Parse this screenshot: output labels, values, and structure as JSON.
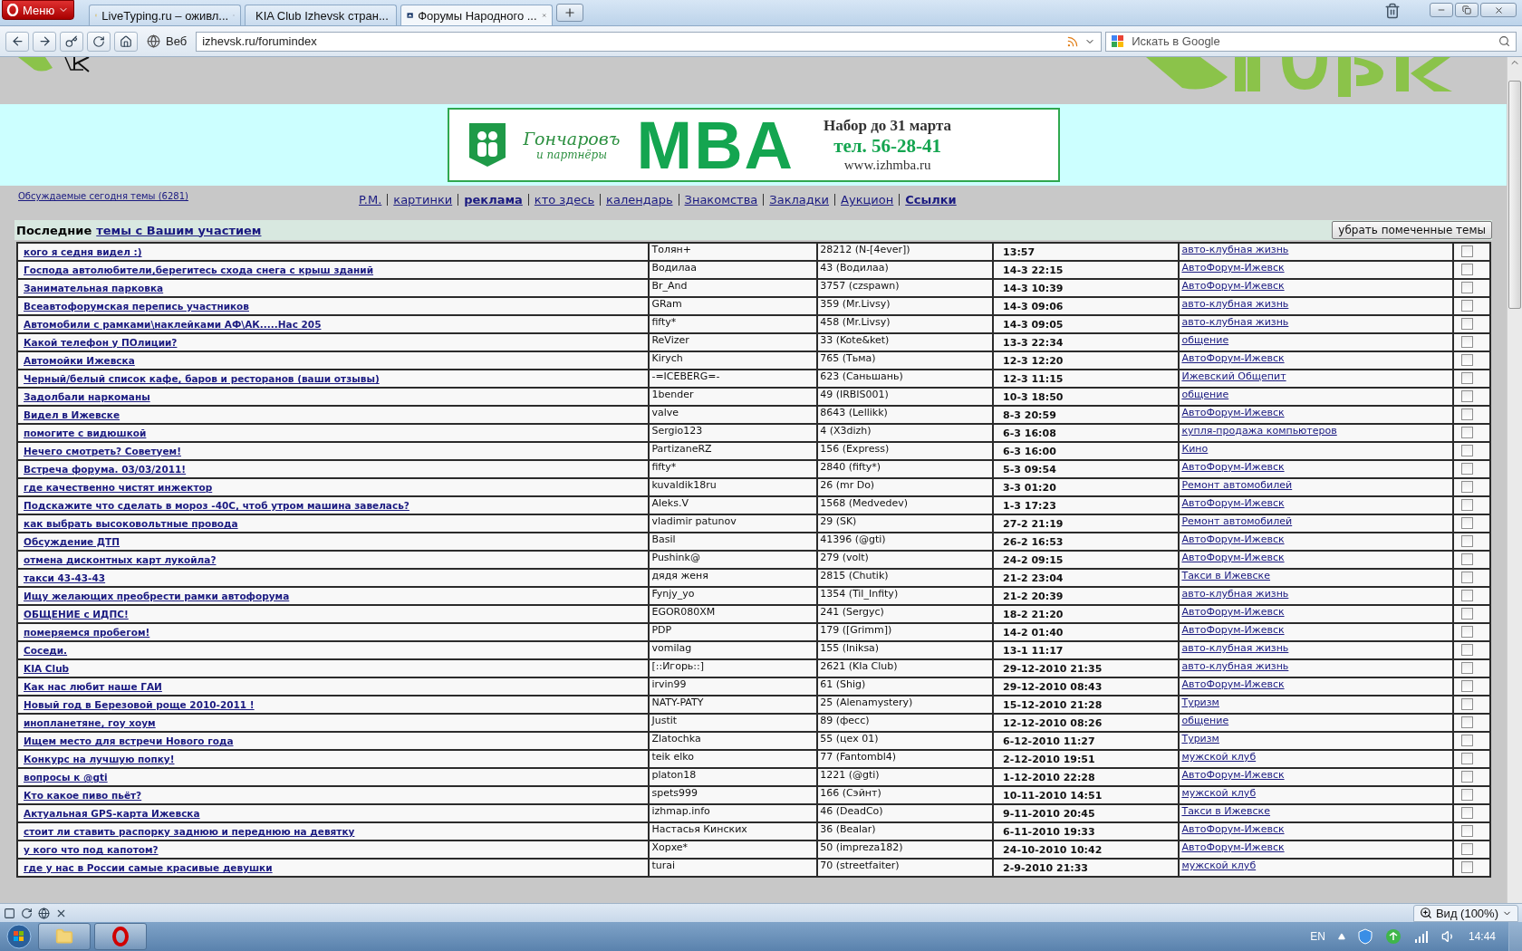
{
  "browser": {
    "menu_label": "Меню",
    "tabs": [
      {
        "title": "LiveTyping.ru – оживл...",
        "selected": false
      },
      {
        "title": "KIA Club Izhevsk стран...",
        "selected": false
      },
      {
        "title": "Форумы Народного ...",
        "selected": true
      }
    ],
    "web_label": "Веб",
    "address": "izhevsk.ru/forumindex",
    "search": {
      "placeholder": "Искать в Google"
    }
  },
  "banner": {
    "brand": "Гончаровъ",
    "brand_sub": "и партнёры",
    "headline": "MBA",
    "enrollment": "Набор до 31 марта",
    "phone": "тел. 56-28-41",
    "url": "www.izhmba.ru"
  },
  "today_link": "Обсуждаемые сегодня темы (6281)",
  "nav_links": [
    {
      "label": "P.M.",
      "bold": false
    },
    {
      "label": "картинки",
      "bold": false
    },
    {
      "label": "реклама",
      "bold": true
    },
    {
      "label": "кто здесь",
      "bold": false
    },
    {
      "label": "календарь",
      "bold": false
    },
    {
      "label": "Знакомства",
      "bold": false
    },
    {
      "label": "Закладки",
      "bold": false
    },
    {
      "label": "Аукцион",
      "bold": false
    },
    {
      "label": "Ссылки",
      "bold": true
    }
  ],
  "section": {
    "prefix": "Последние",
    "link": "темы с Вашим участием",
    "button": "убрать помеченные темы"
  },
  "topics": [
    {
      "title": "кого я седня видел :)",
      "author": "Толян+",
      "replies": "28212 (N-[4ever])",
      "last_post": "13:57",
      "forum": "авто-клубная жизнь",
      "checked": false
    },
    {
      "title": "Господа автолюбители,берегитесь схода снега с крыш зданий",
      "author": "Водилаа",
      "replies": "43 (Водилаа)",
      "last_post": "14-3 22:15",
      "forum": "АвтоФорум-Ижевск",
      "checked": false
    },
    {
      "title": "Занимательная парковка",
      "author": "Br_And",
      "replies": "3757 (czspawn)",
      "last_post": "14-3 10:39",
      "forum": "АвтоФорум-Ижевск",
      "checked": false
    },
    {
      "title": "Всеавтофорумская перепись участников",
      "author": "GRam",
      "replies": "359 (Mr.Livsy)",
      "last_post": "14-3 09:06",
      "forum": "авто-клубная жизнь",
      "checked": false
    },
    {
      "title": "Автомобили с рамками\\наклейками АФ\\АК.....Нас 205",
      "author": "fifty*",
      "replies": "458 (Mr.Livsy)",
      "last_post": "14-3 09:05",
      "forum": "авто-клубная жизнь",
      "checked": false
    },
    {
      "title": "Какой телефон у ПОлиции?",
      "author": "ReVizer",
      "replies": "33 (Kote&ket)",
      "last_post": "13-3 22:34",
      "forum": "общение",
      "checked": false
    },
    {
      "title": "Автомойки Ижевска",
      "author": "Kirych",
      "replies": "765 (Тьма)",
      "last_post": "12-3 12:20",
      "forum": "АвтоФорум-Ижевск",
      "checked": false
    },
    {
      "title": "Черный/белый список кафе, баров и ресторанов (ваши отзывы)",
      "author": "-=ICEBERG=-",
      "replies": "623 (Саньшань)",
      "last_post": "12-3 11:15",
      "forum": "Ижевский Общепит",
      "checked": false
    },
    {
      "title": "Задолбали наркоманы",
      "author": "1bender",
      "replies": "49 (IRBIS001)",
      "last_post": "10-3 18:50",
      "forum": "общение",
      "checked": false
    },
    {
      "title": "Видел в Ижевске",
      "author": "valve",
      "replies": "8643 (Lellikk)",
      "last_post": "8-3 20:59",
      "forum": "АвтоФорум-Ижевск",
      "checked": false
    },
    {
      "title": "помогите с видюшкой",
      "author": "Sergio123",
      "replies": "4 (X3dizh)",
      "last_post": "6-3 16:08",
      "forum": "купля-продажа компьютеров",
      "checked": false
    },
    {
      "title": "Нечего смотреть? Советуем!",
      "author": "PartizaneRZ",
      "replies": "156 (Express)",
      "last_post": "6-3 16:00",
      "forum": "Кино",
      "checked": false
    },
    {
      "title": "Встреча форума. 03/03/2011!",
      "author": "fifty*",
      "replies": "2840 (fifty*)",
      "last_post": "5-3 09:54",
      "forum": "АвтоФорум-Ижевск",
      "checked": false
    },
    {
      "title": "где качественно чистят инжектор",
      "author": "kuvaldik18ru",
      "replies": "26 (mr Do)",
      "last_post": "3-3 01:20",
      "forum": "Ремонт автомобилей",
      "checked": false
    },
    {
      "title": "Подскажите что сделать в мороз -40С, чтоб утром машина завелась?",
      "author": "Aleks.V",
      "replies": "1568 (Medvedev)",
      "last_post": "1-3 17:23",
      "forum": "АвтоФорум-Ижевск",
      "checked": false
    },
    {
      "title": "как выбрать высоковольтные провода",
      "author": "vladimir patunov",
      "replies": "29 (SK)",
      "last_post": "27-2 21:19",
      "forum": "Ремонт автомобилей",
      "checked": false
    },
    {
      "title": "Обсуждение ДТП",
      "author": "Basil",
      "replies": "41396 (@gti)",
      "last_post": "26-2 16:53",
      "forum": "АвтоФорум-Ижевск",
      "checked": false
    },
    {
      "title": "отмена дисконтных карт лукойла?",
      "author": "Pushink@",
      "replies": "279 (volt)",
      "last_post": "24-2 09:15",
      "forum": "АвтоФорум-Ижевск",
      "checked": false
    },
    {
      "title": "такси 43-43-43",
      "author": "дядя женя",
      "replies": "2815 (Chutik)",
      "last_post": "21-2 23:04",
      "forum": "Такси в Ижевске",
      "checked": false
    },
    {
      "title": "Ищу желающих преобрести рамки автофорума",
      "author": "Fynjy_yo",
      "replies": "1354 (Til_Infity)",
      "last_post": "21-2 20:39",
      "forum": "авто-клубная жизнь",
      "checked": false
    },
    {
      "title": "ОБЩЕНИЕ с ИДПС!",
      "author": "EGOR080XM",
      "replies": "241 (Sergyc)",
      "last_post": "18-2 21:20",
      "forum": "АвтоФорум-Ижевск",
      "checked": false
    },
    {
      "title": "померяемся пробегом!",
      "author": "PDP",
      "replies": "179 ([Grimm])",
      "last_post": "14-2 01:40",
      "forum": "АвтоФорум-Ижевск",
      "checked": false
    },
    {
      "title": "Соседи.",
      "author": "vomilag",
      "replies": "155 (lniksa)",
      "last_post": "13-1 11:17",
      "forum": "авто-клубная жизнь",
      "checked": false
    },
    {
      "title": "KIA Club",
      "author": "[::Игорь::]",
      "replies": "2621 (KIa Club)",
      "last_post": "29-12-2010 21:35",
      "forum": "авто-клубная жизнь",
      "checked": false
    },
    {
      "title": "Как нас любит наше ГАИ",
      "author": "irvin99",
      "replies": "61 (Shig)",
      "last_post": "29-12-2010 08:43",
      "forum": "АвтоФорум-Ижевск",
      "checked": false
    },
    {
      "title": "Новый год в Березовой роще 2010-2011 !",
      "author": "NATY-PATY",
      "replies": "25 (Alenamystery)",
      "last_post": "15-12-2010 21:28",
      "forum": "Туризм",
      "checked": false
    },
    {
      "title": "инопланетяне, гоу хоум",
      "author": "Justit",
      "replies": "89 (фесс)",
      "last_post": "12-12-2010 08:26",
      "forum": "общение",
      "checked": false
    },
    {
      "title": "Ищем место для встречи Нового года",
      "author": "Zlatochka",
      "replies": "55 (цех 01)",
      "last_post": "6-12-2010 11:27",
      "forum": "Туризм",
      "checked": false
    },
    {
      "title": "Конкурс на лучшую попку!",
      "author": "teik elko",
      "replies": "77 (Fantombl4)",
      "last_post": "2-12-2010 19:51",
      "forum": "мужской клуб",
      "checked": false
    },
    {
      "title": "вопросы к @gti",
      "author": "platon18",
      "replies": "1221 (@gti)",
      "last_post": "1-12-2010 22:28",
      "forum": "АвтоФорум-Ижевск",
      "checked": false
    },
    {
      "title": "Кто какое пиво пьёт?",
      "author": "spets999",
      "replies": "166 (Сэйнт)",
      "last_post": "10-11-2010 14:51",
      "forum": "мужской клуб",
      "checked": false
    },
    {
      "title": "Актуальная GPS-карта Ижевска",
      "author": "izhmap.info",
      "replies": "46 (DeadCo)",
      "last_post": "9-11-2010 20:45",
      "forum": "Такси в Ижевске",
      "checked": false
    },
    {
      "title": "стоит ли ставить распорку заднюю и переднюю на девятку",
      "author": "Настасья Кинских",
      "replies": "36 (Bealar)",
      "last_post": "6-11-2010 19:33",
      "forum": "АвтоФорум-Ижевск",
      "checked": false
    },
    {
      "title": "у кого что под капотом?",
      "author": "Xopxe*",
      "replies": "50 (impreza182)",
      "last_post": "24-10-2010 10:42",
      "forum": "АвтоФорум-Ижевск",
      "checked": false
    },
    {
      "title": "где у нас в России самые красивые девушки",
      "author": "turai",
      "replies": "70 (streetfaiter)",
      "last_post": "2-9-2010 21:33",
      "forum": "мужской клуб",
      "checked": false
    }
  ],
  "status_bar": {
    "zoom": "Вид (100%)"
  },
  "taskbar": {
    "language": "EN",
    "clock": "14:44"
  }
}
